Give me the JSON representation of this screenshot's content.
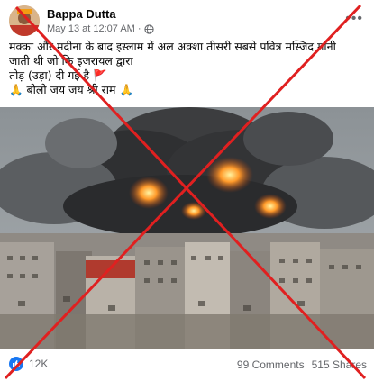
{
  "post": {
    "author": "Bappa Dutta",
    "date": "May 13 at 12:07 AM",
    "privacy_icon": "globe-icon",
    "more_icon": "more-options-icon",
    "text_lines": [
      "मक्का और मदीना के बाद इस्लाम में अल अक्शा तीसरी सबसे पवित्र मस्जिद मानी",
      "जाती थी जो कि इजरायल द्वारा",
      "तोड़ (उड़ा) दी गई है 🚩",
      "🙏 बोलो जय जय श्री राम 🙏"
    ],
    "reaction_count": "12K",
    "comments": "99 Comments",
    "shares": "515 Shares"
  },
  "colors": {
    "cross": "#e02020",
    "like": "#1877f2"
  }
}
